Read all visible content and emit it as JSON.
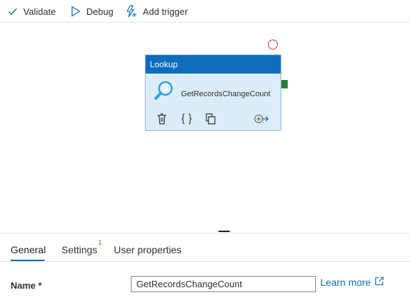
{
  "toolbar": {
    "validate_label": "Validate",
    "debug_label": "Debug",
    "add_trigger_label": "Add trigger"
  },
  "activity": {
    "type": "Lookup",
    "name": "GetRecordsChangeCount",
    "icon": "search-icon",
    "actions": [
      "delete-icon",
      "code-braces-icon",
      "copy-icon",
      "add-output-icon"
    ]
  },
  "tabs": [
    {
      "label": "General",
      "active": true
    },
    {
      "label": "Settings",
      "badge": "1"
    },
    {
      "label": "User properties"
    }
  ],
  "form": {
    "name_label": "Name *",
    "name_value": "GetRecordsChangeCount",
    "learn_more": "Learn more"
  },
  "colors": {
    "accent": "#0f6cbd",
    "activity_fill": "#dcedf9",
    "error": "#d13438",
    "success_handle": "#2d7d3a"
  }
}
